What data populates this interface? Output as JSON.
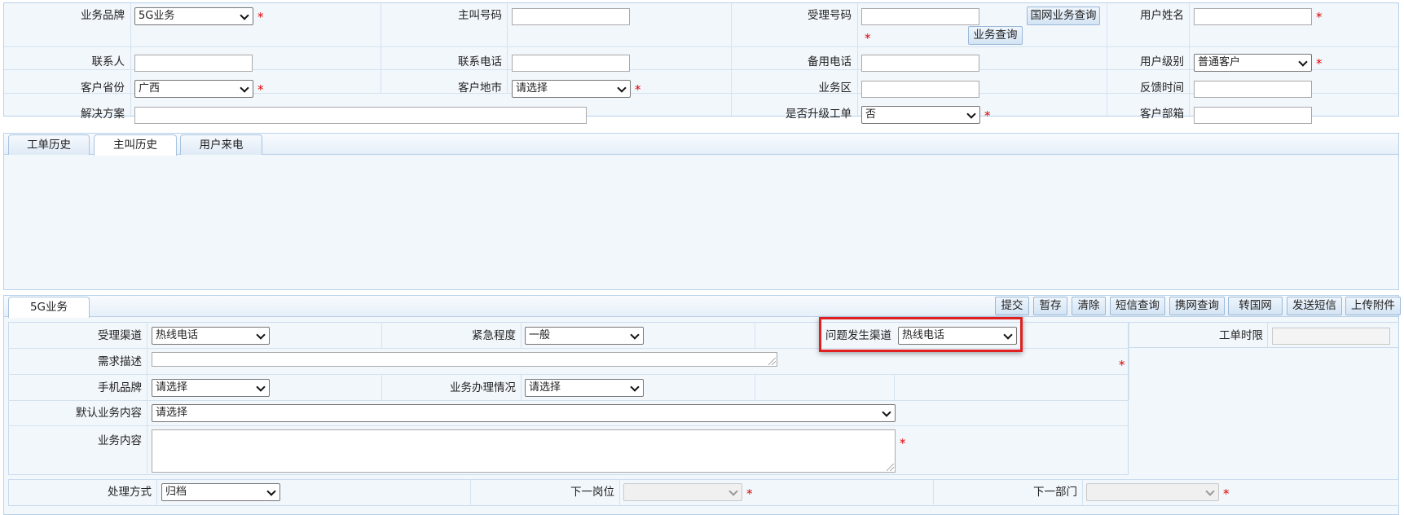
{
  "top_form": {
    "biz_brand": {
      "label": "业务品牌",
      "value": "5G业务"
    },
    "caller_number": {
      "label": "主叫号码",
      "value": ""
    },
    "accept_number": {
      "label": "受理号码",
      "value": ""
    },
    "guowang_query_button": "国网业务查询",
    "biz_query_button": "业务查询",
    "user_name": {
      "label": "用户姓名",
      "value": ""
    },
    "contact": {
      "label": "联系人",
      "value": ""
    },
    "contact_phone": {
      "label": "联系电话",
      "value": ""
    },
    "backup_phone": {
      "label": "备用电话",
      "value": ""
    },
    "user_level": {
      "label": "用户级别",
      "value": "普通客户"
    },
    "province": {
      "label": "客户省份",
      "value": "广西"
    },
    "city": {
      "label": "客户地市",
      "value": "请选择"
    },
    "biz_area": {
      "label": "业务区",
      "value": ""
    },
    "feedback_time": {
      "label": "反馈时间",
      "value": ""
    },
    "solution": {
      "label": "解决方案",
      "value": ""
    },
    "upgrade_ticket": {
      "label": "是否升级工单",
      "value": "否"
    },
    "email": {
      "label": "客户部箱",
      "value": ""
    },
    "required_mark": "*"
  },
  "history_tabs": [
    {
      "label": "工单历史",
      "active": false
    },
    {
      "label": "主叫历史",
      "active": true
    },
    {
      "label": "用户来电",
      "active": false
    }
  ],
  "biz_panel": {
    "tab_label": "5G业务",
    "toolbar": [
      "提交",
      "暂存",
      "清除",
      "短信查询",
      "携网查询",
      "转国网",
      "发送短信",
      "上传附件"
    ],
    "accept_channel": {
      "label": "受理渠道",
      "value": "热线电话"
    },
    "urgency": {
      "label": "紧急程度",
      "value": "一般"
    },
    "problem_channel": {
      "label": "问题发生渠道",
      "value": "热线电话"
    },
    "ticket_deadline": {
      "label": "工单时限",
      "value": ""
    },
    "requirement": {
      "label": "需求描述",
      "value": ""
    },
    "phone_brand": {
      "label": "手机品牌",
      "value": "请选择"
    },
    "biz_handling": {
      "label": "业务办理情况",
      "value": "请选择"
    },
    "default_content": {
      "label": "默认业务内容",
      "value": "请选择"
    },
    "biz_content": {
      "label": "业务内容",
      "value": ""
    }
  },
  "bottom": {
    "handle_method": {
      "label": "处理方式",
      "value": "归档"
    },
    "next_post": {
      "label": "下一岗位",
      "value": ""
    },
    "next_dept": {
      "label": "下一部门",
      "value": ""
    }
  },
  "colors": {
    "required": "#e00000",
    "highlight_border": "#e02020",
    "panel_bg": "#f2f7fc",
    "panel_border": "#b9d1ea"
  }
}
